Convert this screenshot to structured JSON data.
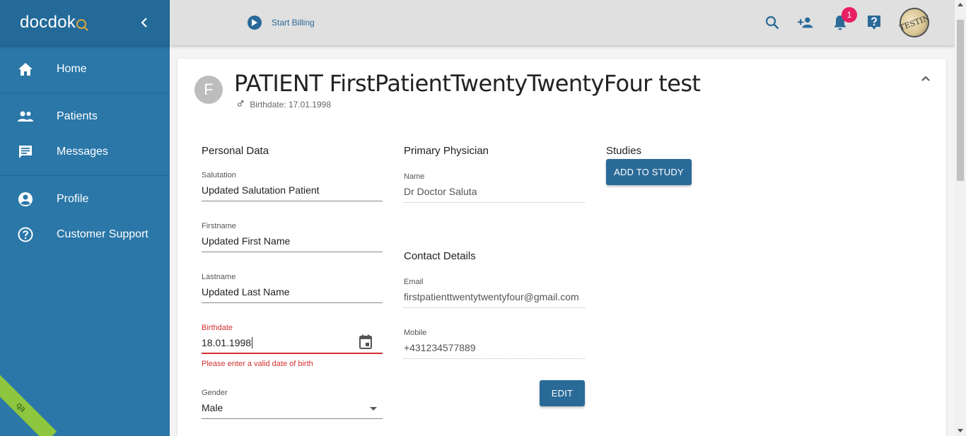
{
  "sidebar": {
    "logo": "docdok",
    "items": [
      {
        "label": "Home"
      },
      {
        "label": "Patients"
      },
      {
        "label": "Messages"
      },
      {
        "label": "Profile"
      },
      {
        "label": "Customer Support"
      }
    ],
    "env_ribbon": "qa"
  },
  "topbar": {
    "start_billing": "Start Billing",
    "notification_count": "1",
    "avatar_text": "TESTIN"
  },
  "patient": {
    "avatar_initial": "F",
    "name": "PATIENT FirstPatientTwentyTwentyFour test",
    "birthdate_line": "Birthdate: 17.01.1998",
    "gender_symbol": "♂"
  },
  "personal_data": {
    "title": "Personal Data",
    "salutation": {
      "label": "Salutation",
      "value": "Updated Salutation Patient"
    },
    "firstname": {
      "label": "Firstname",
      "value": "Updated First Name"
    },
    "lastname": {
      "label": "Lastname",
      "value": "Updated Last Name"
    },
    "birthdate": {
      "label": "Birthdate",
      "value": "18.01.1998",
      "error": "Please enter a valid date of birth"
    },
    "gender": {
      "label": "Gender",
      "value": "Male"
    }
  },
  "primary_physician": {
    "title": "Primary Physician",
    "name": {
      "label": "Name",
      "value": "Dr Doctor Saluta"
    }
  },
  "contact": {
    "title": "Contact Details",
    "email": {
      "label": "Email",
      "value": "firstpatienttwentytwentyfour@gmail.com"
    },
    "mobile": {
      "label": "Mobile",
      "value": "+431234577889"
    },
    "edit_label": "EDIT"
  },
  "studies": {
    "title": "Studies",
    "add_label": "ADD TO STUDY"
  },
  "colors": {
    "sidebar": "#2a77a8",
    "primary": "#2a6a98",
    "error": "#d32f2f",
    "badge": "#e91e63"
  }
}
